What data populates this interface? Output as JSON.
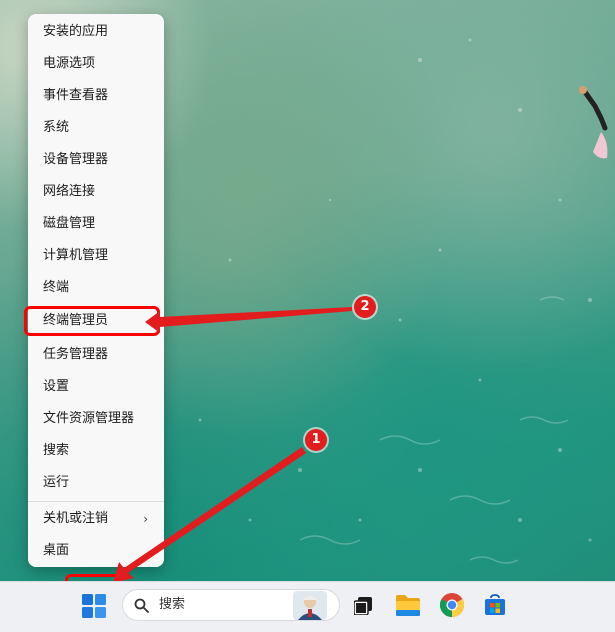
{
  "context_menu": {
    "items": [
      {
        "label": "安装的应用"
      },
      {
        "label": "电源选项"
      },
      {
        "label": "事件查看器"
      },
      {
        "label": "系统"
      },
      {
        "label": "设备管理器"
      },
      {
        "label": "网络连接"
      },
      {
        "label": "磁盘管理"
      },
      {
        "label": "计算机管理"
      },
      {
        "label": "终端"
      },
      {
        "label": "终端管理员"
      },
      {
        "label": "任务管理器"
      },
      {
        "label": "设置"
      },
      {
        "label": "文件资源管理器"
      },
      {
        "label": "搜索"
      },
      {
        "label": "运行"
      },
      {
        "label": "关机或注销",
        "submenu_icon": "chevron-right-icon"
      },
      {
        "label": "桌面"
      }
    ]
  },
  "annotations": {
    "step1": "1",
    "step2": "2",
    "color": "#e31d1d"
  },
  "taskbar": {
    "search_label": "搜索",
    "icons": [
      "windows-start-icon",
      "search-icon",
      "avatar",
      "task-view-icon",
      "file-explorer-icon",
      "chrome-icon",
      "microsoft-store-icon"
    ]
  }
}
